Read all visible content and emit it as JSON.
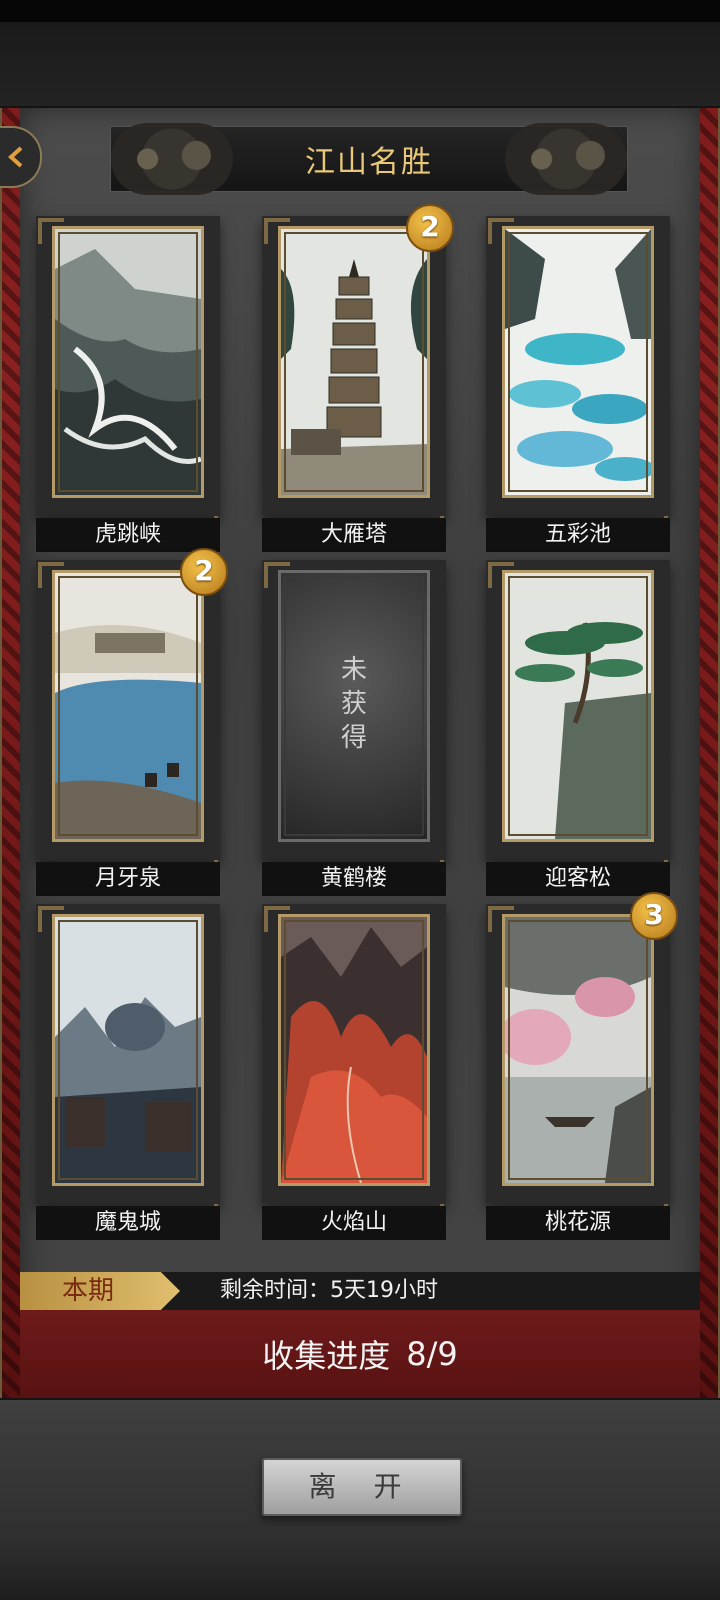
{
  "title": "江山名胜",
  "cards": [
    {
      "label": "虎跳峡",
      "badge": ""
    },
    {
      "label": "大雁塔",
      "badge": "2"
    },
    {
      "label": "五彩池",
      "badge": ""
    },
    {
      "label": "月牙泉",
      "badge": "2"
    },
    {
      "label": "黄鹤楼",
      "badge": "",
      "locked_text": "未\n获\n得"
    },
    {
      "label": "迎客松",
      "badge": ""
    },
    {
      "label": "魔鬼城",
      "badge": ""
    },
    {
      "label": "火焰山",
      "badge": ""
    },
    {
      "label": "桃花源",
      "badge": "3"
    }
  ],
  "period": {
    "tag": "本期",
    "remaining": "剩余时间：5天19小时"
  },
  "progress": {
    "label": "收集进度",
    "value": "8/9"
  },
  "leave_label": "离 开",
  "icons": {
    "back": "back-arrow-icon"
  },
  "colors": {
    "accent_gold": "#e9c879",
    "panel": "#444444",
    "banner_red": "#6e1a1a"
  }
}
